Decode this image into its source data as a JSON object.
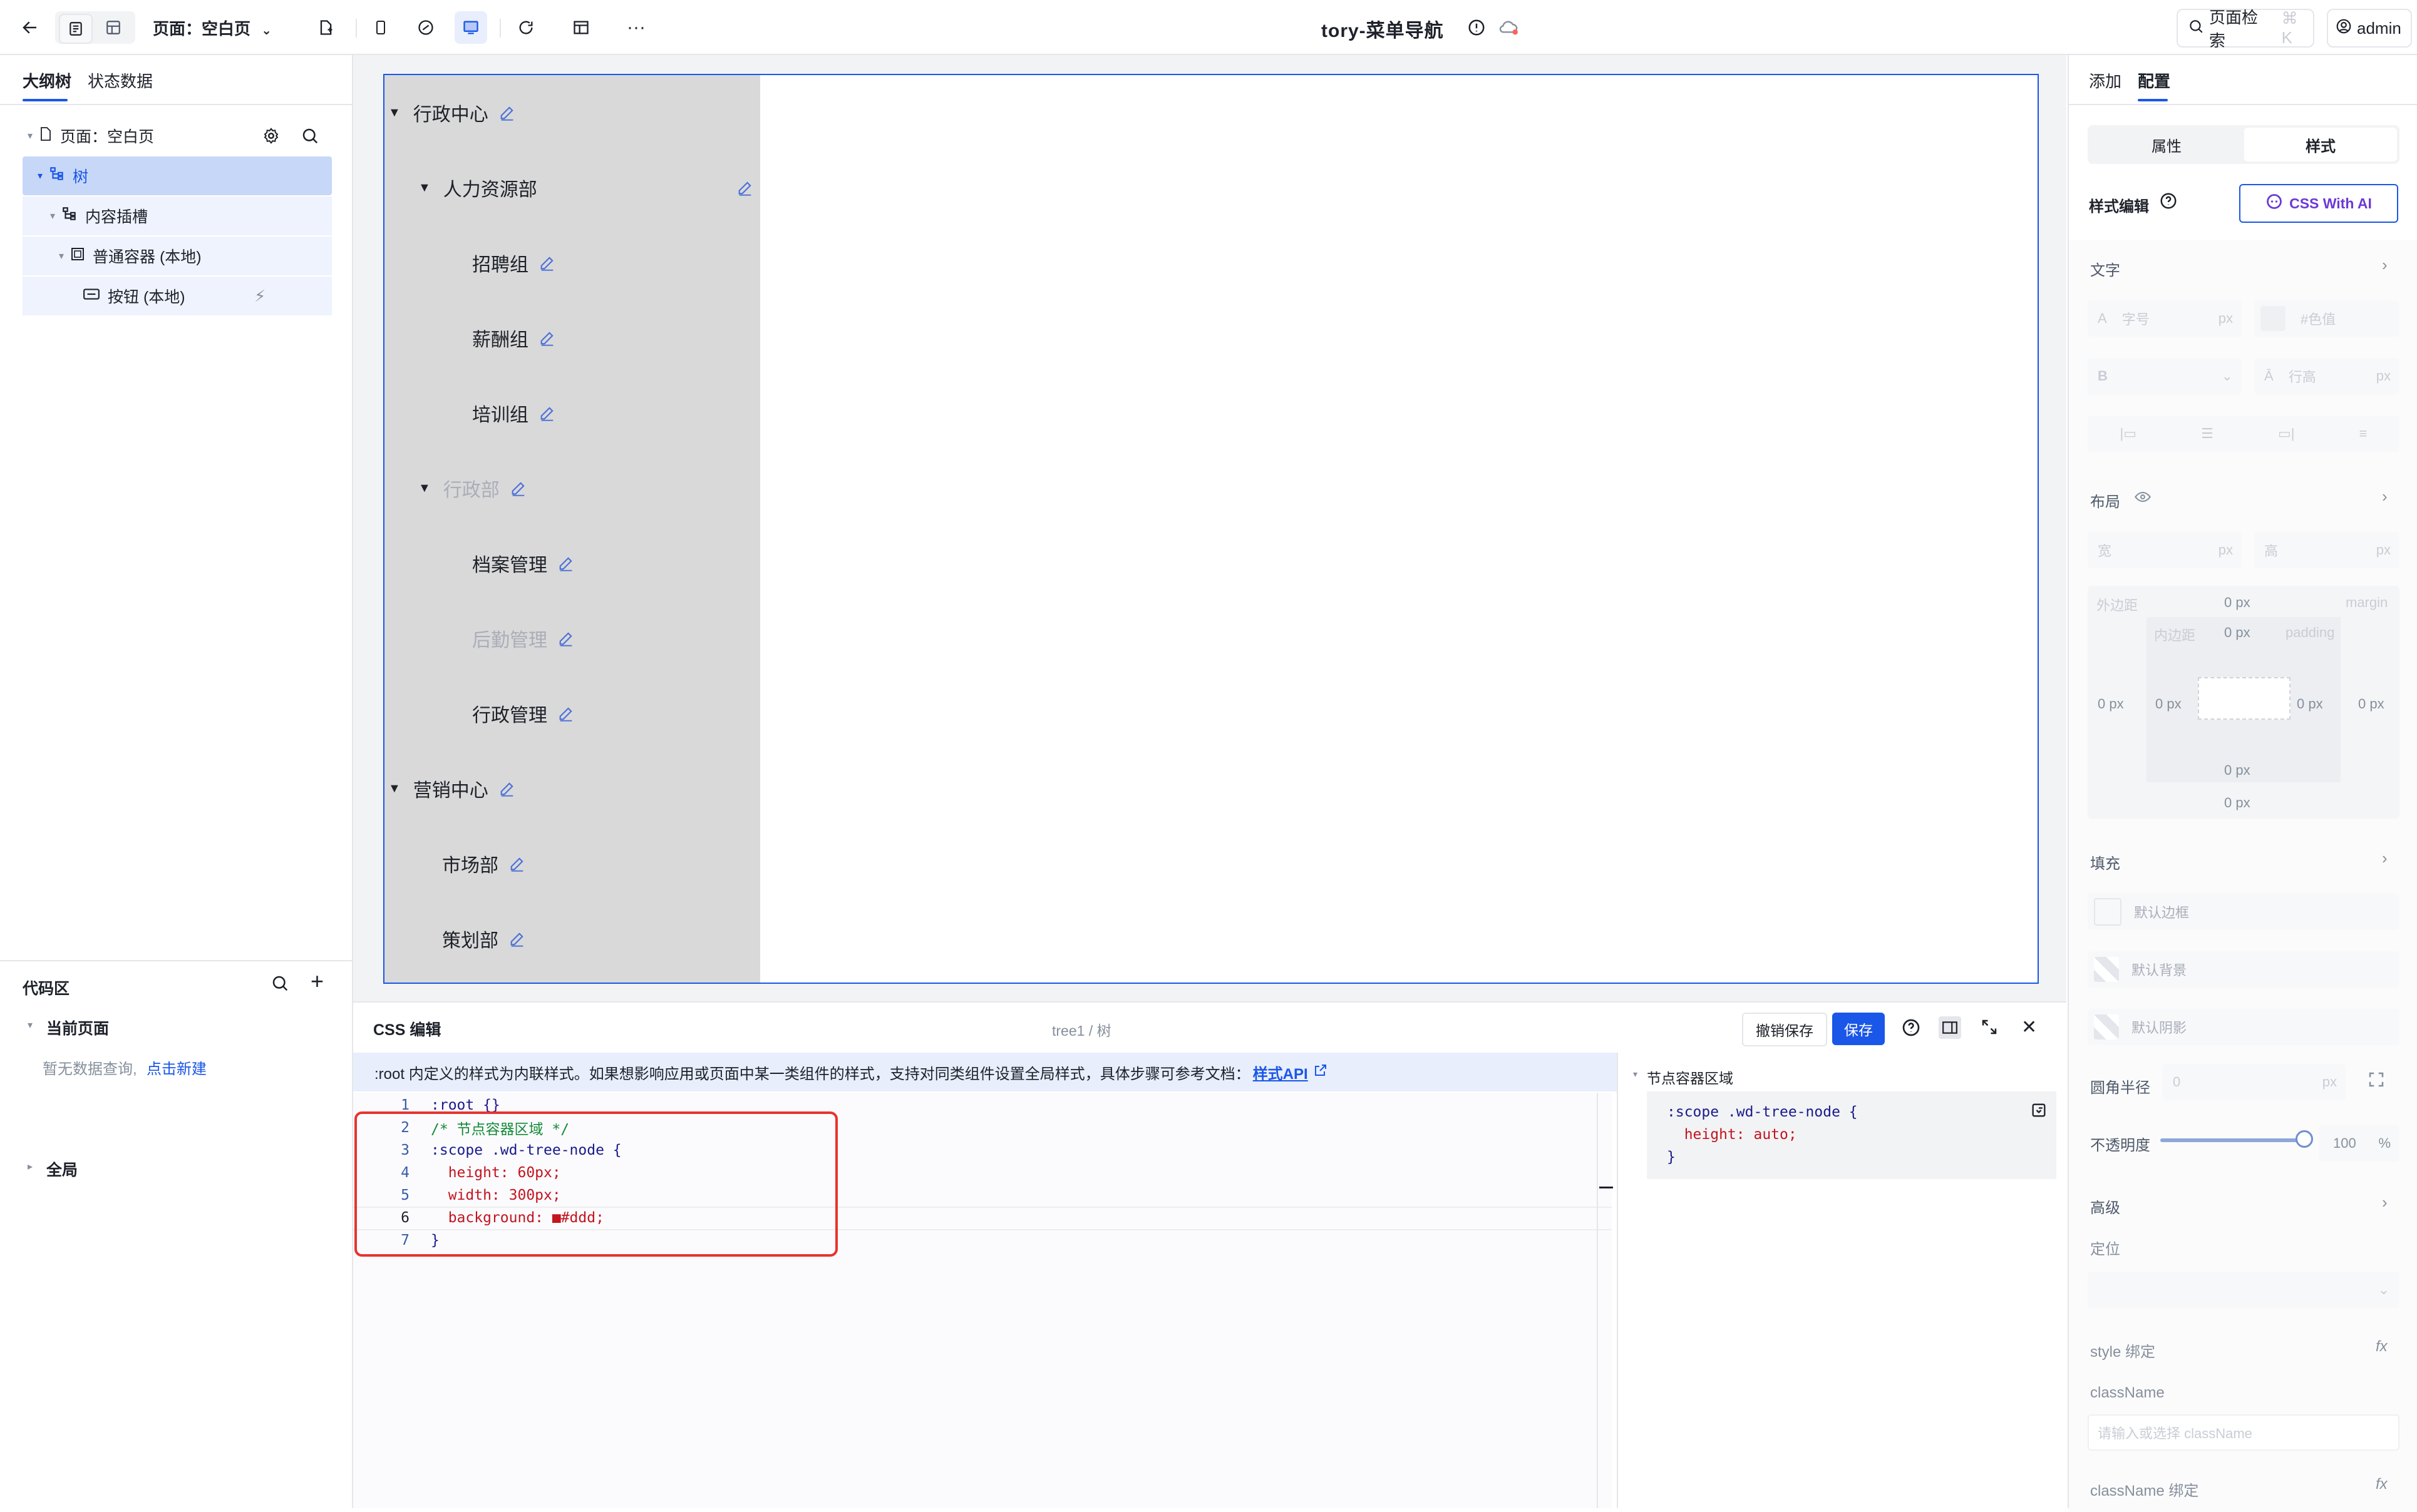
{
  "topbar": {
    "page_label": "页面：空白页",
    "app_title": "tory-菜单导航",
    "search_label": "页面检索",
    "search_shortcut": "⌘ K",
    "user": "admin"
  },
  "left_panel": {
    "tabs": [
      "大纲树",
      "状态数据"
    ],
    "outline": [
      {
        "label": "页面：空白页"
      },
      {
        "label": "树"
      },
      {
        "label": "内容插槽"
      },
      {
        "label": "普通容器 (本地)"
      },
      {
        "label": "按钮 (本地)"
      }
    ],
    "code_section": {
      "title": "代码区",
      "current_page": "当前页面",
      "empty_text": "暂无数据查询,",
      "create_link": "点击新建",
      "global": "全局"
    }
  },
  "canvas": {
    "nodes": [
      {
        "label": "行政中心"
      },
      {
        "label": "人力资源部"
      },
      {
        "label": "招聘组"
      },
      {
        "label": "薪酬组"
      },
      {
        "label": "培训组"
      },
      {
        "label": "行政部"
      },
      {
        "label": "档案管理"
      },
      {
        "label": "后勤管理"
      },
      {
        "label": "行政管理"
      },
      {
        "label": "营销中心"
      },
      {
        "label": "市场部"
      },
      {
        "label": "策划部"
      }
    ]
  },
  "css_editor": {
    "title": "CSS 编辑",
    "path": "tree1 / 树",
    "revert_label": "撤销保存",
    "save_label": "保存",
    "info_text": ":root 内定义的样式为内联样式。如果想影响应用或页面中某一类组件的样式，支持对同类组件设置全局样式，具体步骤可参考文档：",
    "info_link": "样式API",
    "lines": [
      {
        "no": "1",
        "text": ":root {}"
      },
      {
        "no": "2",
        "text": "/* 节点容器区域 */"
      },
      {
        "no": "3",
        "text": ":scope .wd-tree-node {"
      },
      {
        "no": "4",
        "text": "  height: 60px;"
      },
      {
        "no": "5",
        "text": "  width: 300px;"
      },
      {
        "no": "6",
        "text": "  background: ■#ddd;"
      },
      {
        "no": "7",
        "text": "}"
      }
    ],
    "preview": {
      "title": "节点容器区域",
      "lines": [
        ":scope .wd-tree-node {",
        "  height: auto;",
        "}"
      ]
    }
  },
  "right_panel": {
    "tabs": [
      "添加",
      "配置"
    ],
    "mode_tabs": [
      "属性",
      "样式"
    ],
    "style_edit_label": "样式编辑",
    "css_ai_label": "CSS With AI",
    "text_section": "文字",
    "font_size_placeholder": "字号",
    "color_placeholder": "#色值",
    "line_height_placeholder": "行高",
    "unit_px": "px",
    "layout_section": "布局",
    "width_label": "宽",
    "height_label": "高",
    "margin_label": "外边距",
    "margin_en": "margin",
    "padding_label": "内边距",
    "padding_en": "padding",
    "zero_px": "0 px",
    "fill_section": "填充",
    "border_default": "默认边框",
    "bg_default": "默认背景",
    "shadow_default": "默认阴影",
    "radius_label": "圆角半径",
    "radius_value": "0",
    "opacity_label": "不透明度",
    "opacity_value": "100",
    "opacity_unit": "%",
    "opacity_fraction": 1.0,
    "advanced_section": "高级",
    "position_label": "定位",
    "style_bind": "style 绑定",
    "classname_label": "className",
    "classname_placeholder": "请输入或选择 className",
    "classname_bind": "className 绑定"
  },
  "colors": {
    "primary": "#1a56e8",
    "tree_bg": "#d9d9d9",
    "highlight_red": "#e8332e",
    "css_ai": "#6b3ad6"
  }
}
